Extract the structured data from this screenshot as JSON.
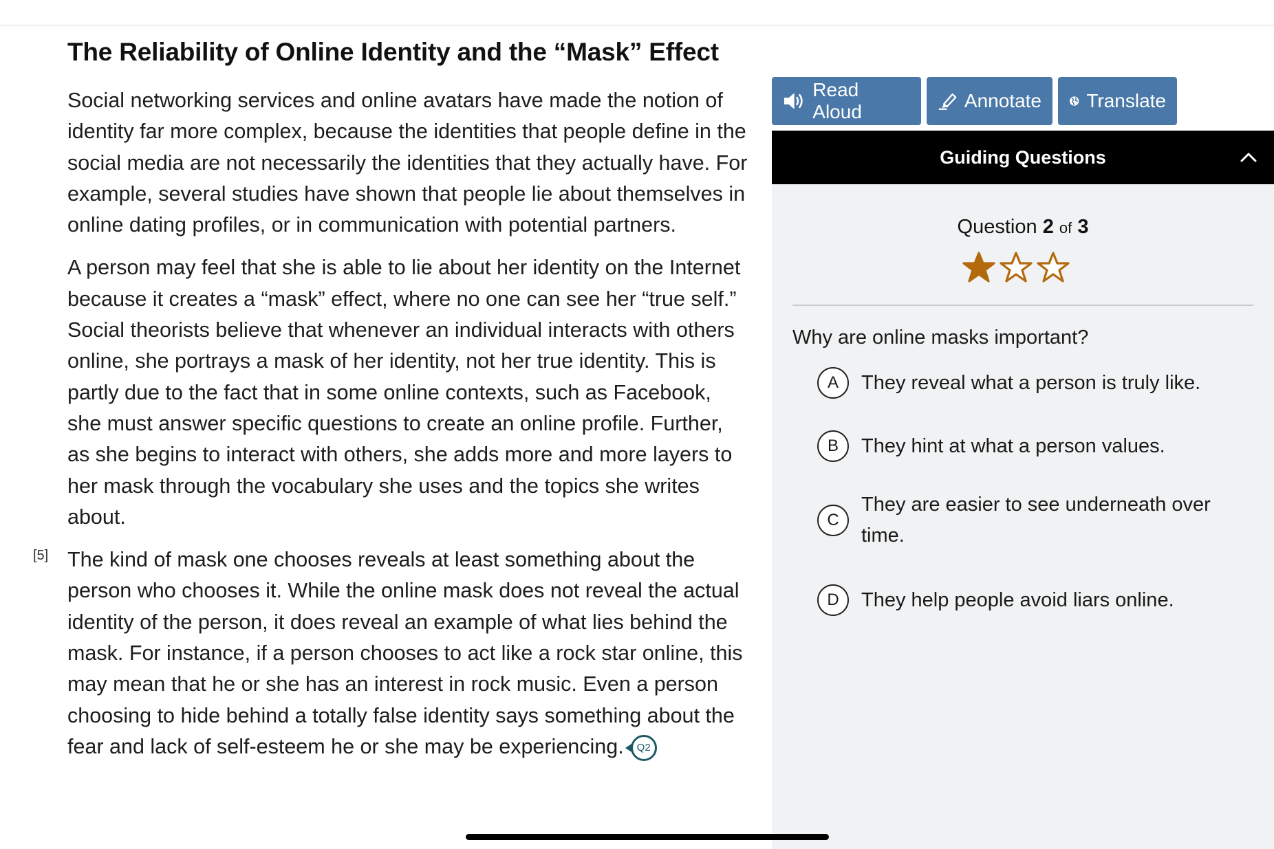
{
  "article": {
    "title": "The Reliability of Online Identity and the “Mask” Effect",
    "paragraphs": [
      "Social networking services and online avatars have made the notion of identity far more complex, because the identities that people define in the social media are not necessarily the identities that they actually have. For example, several studies have shown that people lie about themselves in online dating profiles, or in communication with potential partners.",
      "A person may feel that she is able to lie about her identity on the Internet because it creates a “mask” effect, where no one can see her “true self.” Social theorists believe that whenever an individual interacts with others online, she portrays a mask of her identity, not her true identity. This is partly due to the fact that in some online contexts, such as Facebook, she must answer specific questions to create an online profile. Further, as she begins to interact with others, she adds more and more layers to her mask through the vocabulary she uses and the topics she writes about.",
      "The kind of mask one chooses reveals at least something about the person who chooses it. While the online mask does not reveal the actual identity of the person, it does reveal an example of what lies behind the mask. For instance, if a person chooses to act like a rock star online, this may mean that he or she has an interest in rock music. Even a person choosing to hide behind a totally false identity says something about the fear and lack of self-esteem he or she may be experiencing."
    ],
    "paragraph_number": "[5]",
    "question_marker": "Q2"
  },
  "toolbar": {
    "read_aloud": "Read Aloud",
    "annotate": "Annotate",
    "translate": "Translate"
  },
  "panel": {
    "header": "Guiding Questions",
    "counter_prefix": "Question",
    "current": "2",
    "of_label": "of",
    "total": "3",
    "rating": 1,
    "rating_max": 3,
    "question": "Why are online masks important?",
    "options": [
      {
        "letter": "A",
        "text": "They reveal what a person is truly like."
      },
      {
        "letter": "B",
        "text": "They hint at what a person values."
      },
      {
        "letter": "C",
        "text": "They are easier to see underneath over time."
      },
      {
        "letter": "D",
        "text": "They help people avoid liars online."
      }
    ]
  },
  "colors": {
    "tool_button": "#4a78a8",
    "panel_bg": "#f1f2f3",
    "star": "#b26a0c",
    "marker": "#1e5a64"
  }
}
